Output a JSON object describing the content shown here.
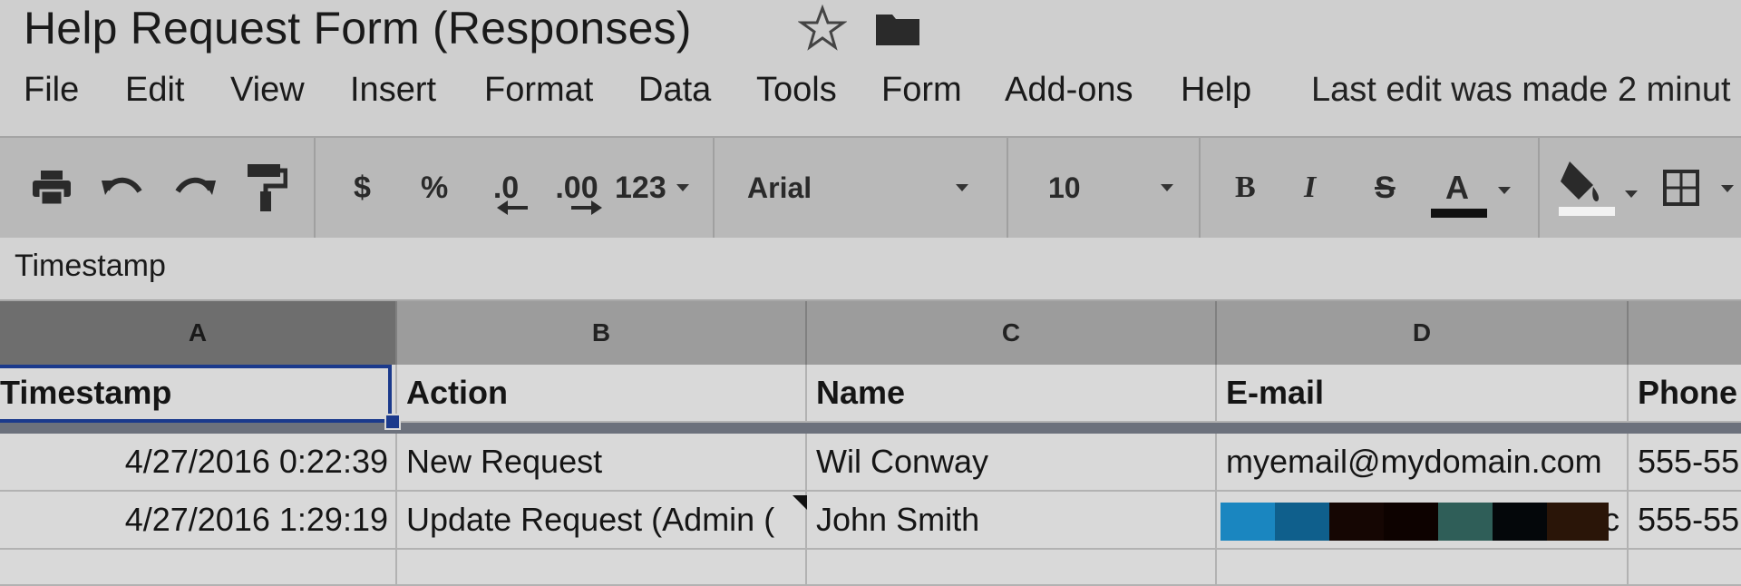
{
  "title": "Help Request Form (Responses)",
  "icons": {
    "star": "star-icon",
    "folder": "folder-icon"
  },
  "menu": [
    "File",
    "Edit",
    "View",
    "Insert",
    "Format",
    "Data",
    "Tools",
    "Form",
    "Add-ons",
    "Help"
  ],
  "last_edit": "Last edit was made 2 minut",
  "toolbar": {
    "currency": "$",
    "percent": "%",
    "dec_less": ".0",
    "dec_more": ".00",
    "more_formats": "123",
    "font": "Arial",
    "font_size": "10",
    "bold": "B",
    "italic": "I",
    "strike": "S",
    "text_color": "A",
    "text_color_value": "#111111"
  },
  "formula_bar": {
    "value": "Timestamp"
  },
  "grid": {
    "columns": [
      "A",
      "B",
      "C",
      "D"
    ],
    "rows": [
      {
        "a": "Timestamp",
        "b": "Action",
        "c": "Name",
        "d": "E-mail",
        "e": "Phone"
      },
      {
        "a": "4/27/2016 0:22:39",
        "b": "New Request",
        "c": "Wil Conway",
        "d": "myemail@mydomain.com",
        "e": "555-55"
      },
      {
        "a": "4/27/2016 1:29:19",
        "b": "Update Request (Admin (",
        "c": "John Smith",
        "d": "c",
        "e": "555-55"
      }
    ]
  },
  "colors": {
    "selection": "#1b3a8c",
    "redaction": [
      "#1a86c0",
      "#0f5f8c",
      "#150603",
      "#0d0200",
      "#2f5e58",
      "#04070a",
      "#2a1508"
    ]
  }
}
